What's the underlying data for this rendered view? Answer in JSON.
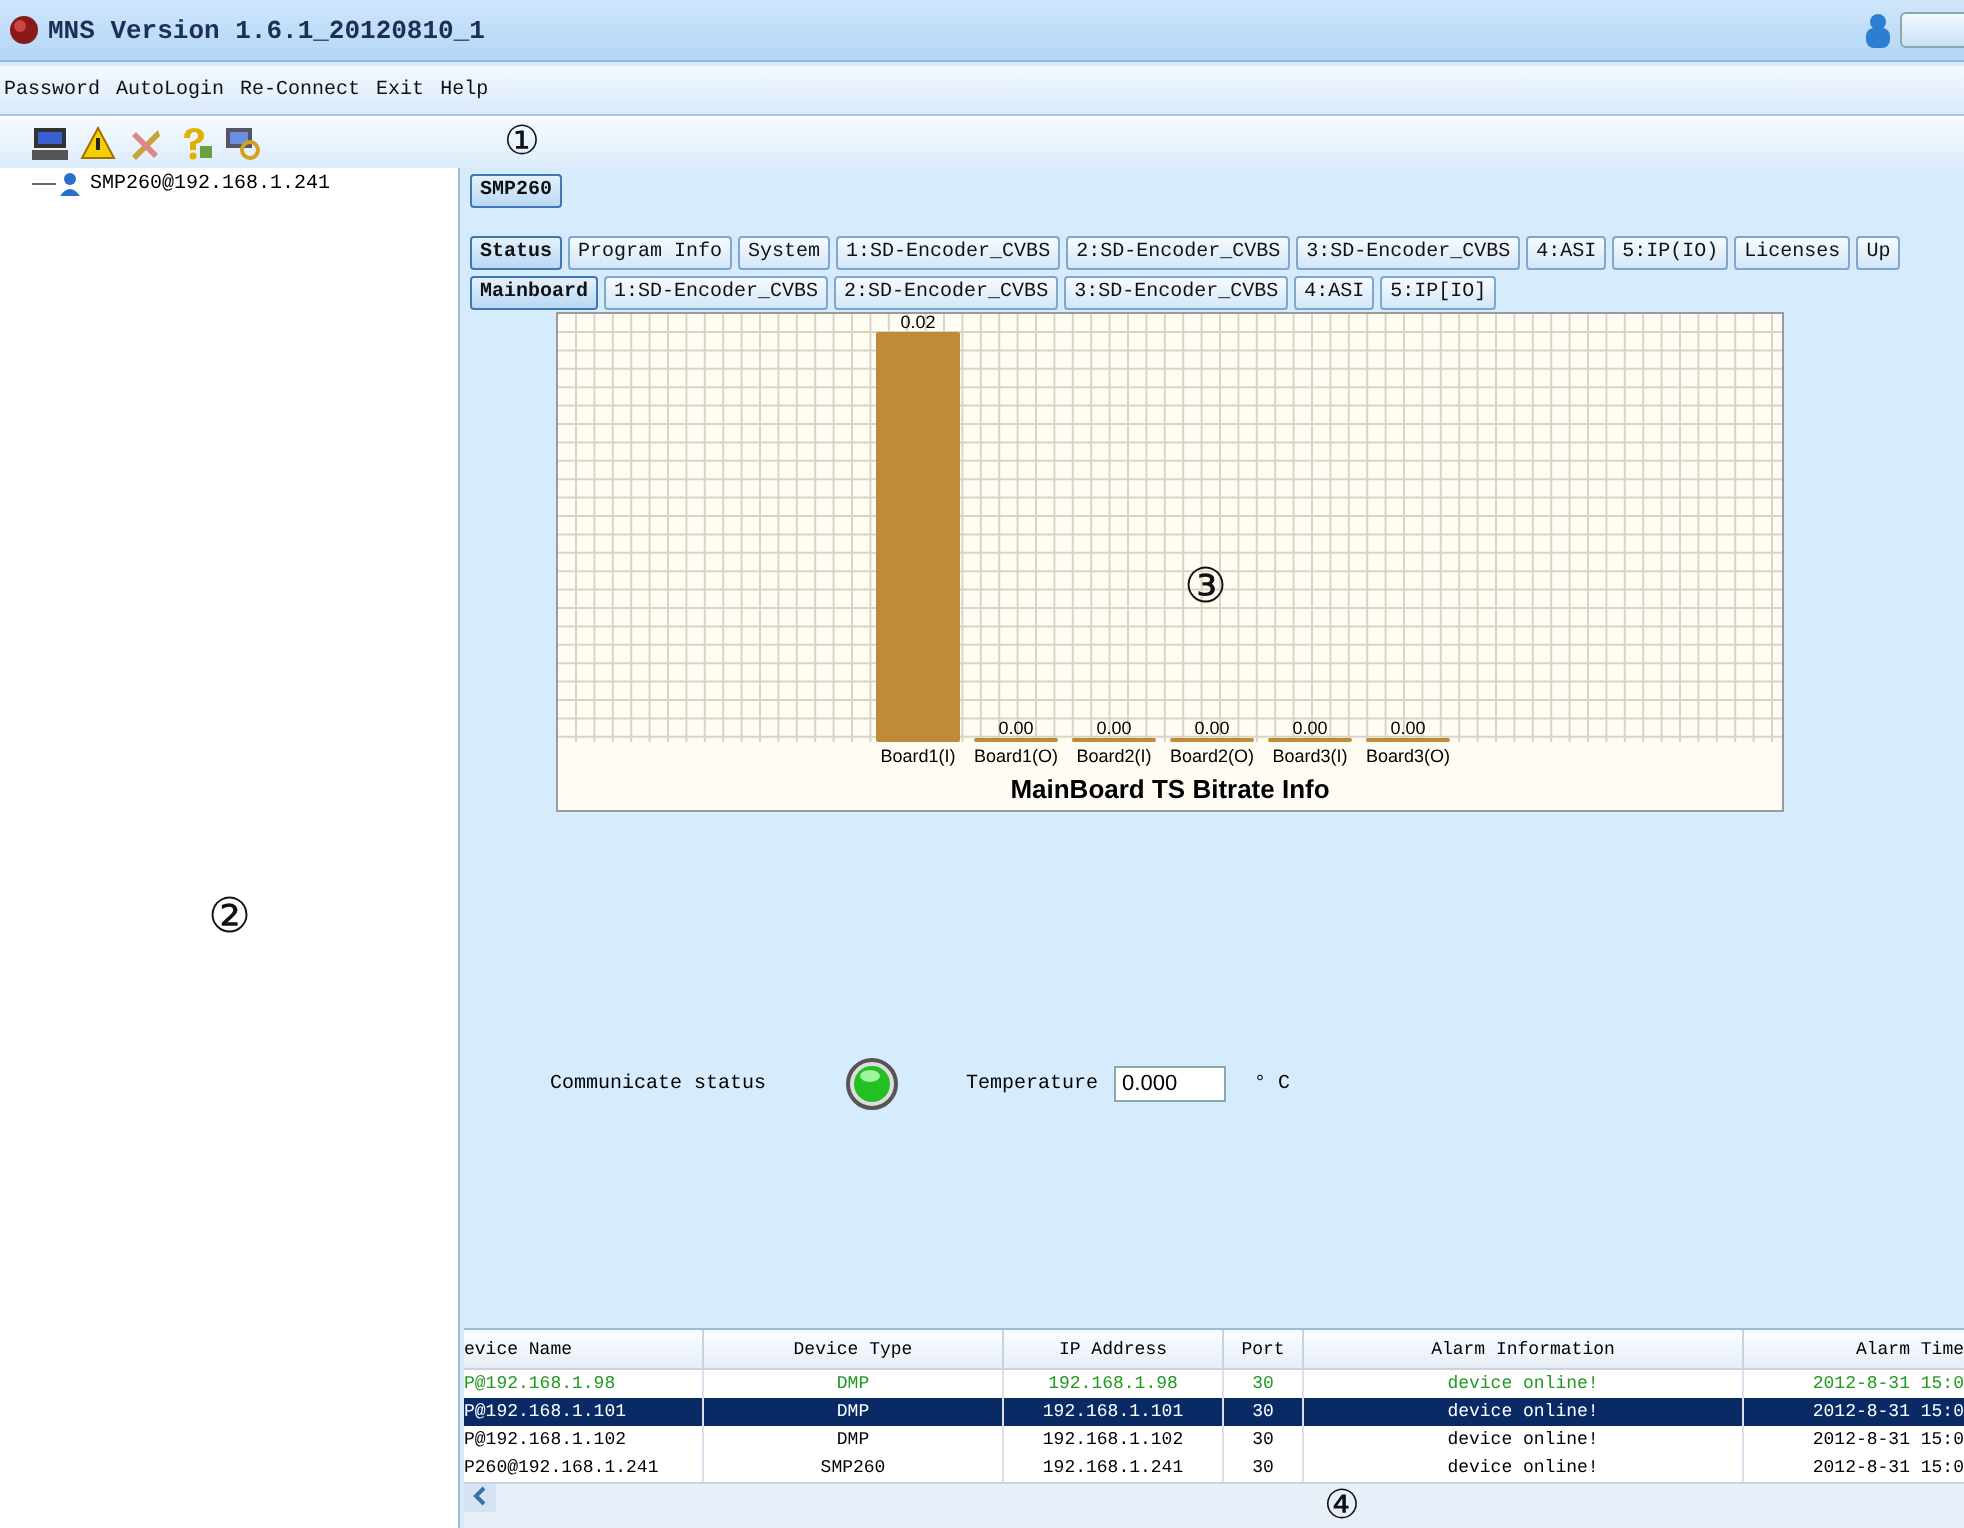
{
  "window": {
    "title": "MNS Version 1.6.1_20120810_1"
  },
  "menu": [
    "Password",
    "AutoLogin",
    "Re-Connect",
    "Exit",
    "Help"
  ],
  "tree": [
    {
      "label": "SMP260@192.168.1.241",
      "selected": false
    }
  ],
  "device_tab": {
    "label": "SMP260",
    "selected": true
  },
  "tabs": [
    {
      "label": "Status",
      "selected": true
    },
    {
      "label": "Program Info",
      "selected": false
    },
    {
      "label": "System",
      "selected": false
    },
    {
      "label": "1:SD-Encoder_CVBS",
      "selected": false
    },
    {
      "label": "2:SD-Encoder_CVBS",
      "selected": false
    },
    {
      "label": "3:SD-Encoder_CVBS",
      "selected": false
    },
    {
      "label": "4:ASI",
      "selected": false
    },
    {
      "label": "5:IP(IO)",
      "selected": false
    },
    {
      "label": "Licenses",
      "selected": false
    },
    {
      "label": "Up",
      "selected": false
    }
  ],
  "subtabs": [
    {
      "label": "Mainboard",
      "selected": true
    },
    {
      "label": "1:SD-Encoder_CVBS",
      "selected": false
    },
    {
      "label": "2:SD-Encoder_CVBS",
      "selected": false
    },
    {
      "label": "3:SD-Encoder_CVBS",
      "selected": false
    },
    {
      "label": "4:ASI",
      "selected": false
    },
    {
      "label": "5:IP[IO]",
      "selected": false
    }
  ],
  "chart_data": {
    "type": "bar",
    "title": "MainBoard TS Bitrate Info",
    "categories": [
      "Board1(I)",
      "Board1(O)",
      "Board2(I)",
      "Board2(O)",
      "Board3(I)",
      "Board3(O)"
    ],
    "series": [
      {
        "color": "#c08a3a",
        "values": [
          0.02,
          0,
          0,
          0,
          0,
          0
        ],
        "value_labels": [
          "0.02",
          "0.00",
          "0.00",
          "0.00",
          "0.00",
          "0.00"
        ]
      }
    ],
    "ylim": [
      0,
      0.02
    ],
    "data_labels": true,
    "grid": true
  },
  "status": {
    "communicate_label": "Communicate status",
    "communicate_on": true,
    "temperature_label": "Temperature",
    "temperature_value": "0.000",
    "temperature_unit": "° C"
  },
  "table": {
    "columns": [
      "evice Name",
      "Device Type",
      "IP Address",
      "Port",
      "Alarm Information",
      "Alarm Time"
    ],
    "rows": [
      {
        "cells": [
          "P@192.168.1.98",
          "DMP",
          "192.168.1.98",
          "30",
          "device online!",
          "2012-8-31 15:0"
        ],
        "color": "#1f9a1f",
        "selected": false
      },
      {
        "cells": [
          "P@192.168.1.101",
          "DMP",
          "192.168.1.101",
          "30",
          "device online!",
          "2012-8-31 15:0"
        ],
        "selected": true
      },
      {
        "cells": [
          "P@192.168.1.102",
          "DMP",
          "192.168.1.102",
          "30",
          "device online!",
          "2012-8-31 15:0"
        ],
        "color": "#000000",
        "selected": false
      },
      {
        "cells": [
          "P260@192.168.1.241",
          "SMP260",
          "192.168.1.241",
          "30",
          "device online!",
          "2012-8-31 15:0"
        ],
        "color": "#000000",
        "selected": false
      }
    ]
  },
  "callouts": [
    "①",
    "②",
    "③",
    "④"
  ]
}
